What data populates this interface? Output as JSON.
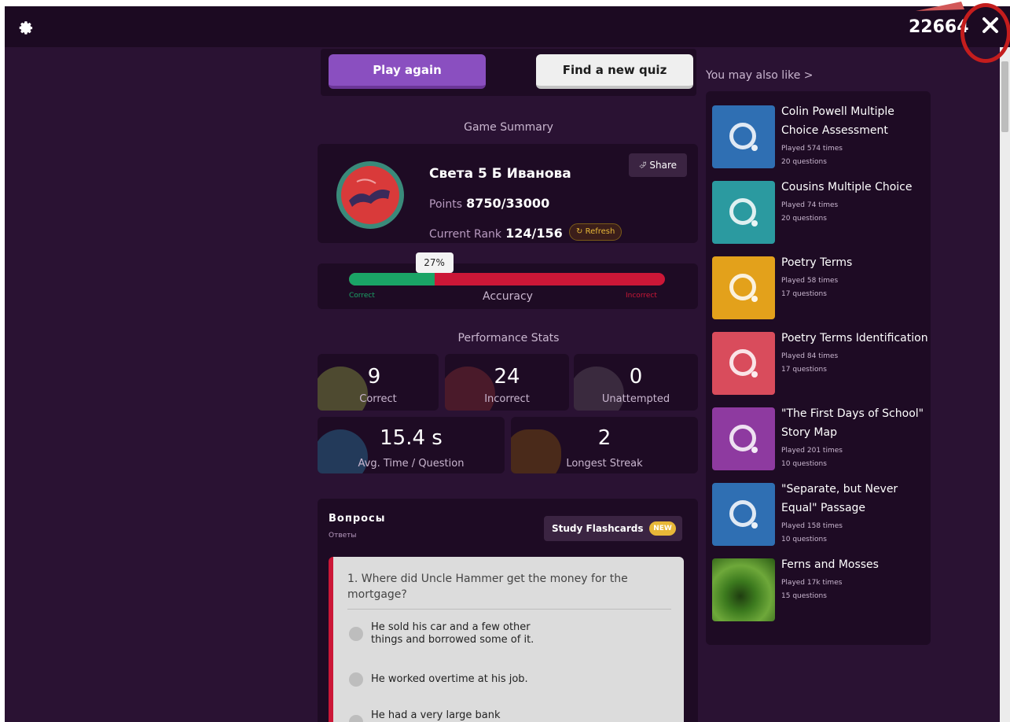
{
  "topbar": {
    "score": "22664",
    "gear_icon": "gear-icon",
    "close_icon": "close-icon"
  },
  "buttons": {
    "play_again": "Play again",
    "find_quiz": "Find a new quiz"
  },
  "summary": {
    "title": "Game Summary",
    "player_name": "Света 5 Б Иванова",
    "points_label": "Points",
    "points_value": "8750/33000",
    "rank_label": "Current Rank",
    "rank_value": "124/156",
    "refresh_label": "Refresh",
    "share_label": "Share"
  },
  "accuracy": {
    "label": "Accuracy",
    "value_text": "27%",
    "correct_label": "Correct",
    "incorrect_label": "Incorrect",
    "percent": 27
  },
  "performance": {
    "title": "Performance Stats",
    "correct_value": "9",
    "correct_label": "Correct",
    "incorrect_value": "24",
    "incorrect_label": "Incorrect",
    "unattempted_value": "0",
    "unattempted_label": "Unattempted",
    "avg_time_value": "15.4 s",
    "avg_time_label": "Avg. Time / Question",
    "streak_value": "2",
    "streak_label": "Longest Streak"
  },
  "review": {
    "title": "Вопросы",
    "subtitle": "Ответы",
    "flash_label": "Study Flashcards",
    "flash_badge": "NEW",
    "question": "1. Where did Uncle Hammer get the money for the mortgage?",
    "options": [
      "He sold his car and a few other things and borrowed some of it.",
      "He worked overtime at his job.",
      "He had a very large bank account."
    ]
  },
  "recommendations": {
    "header": "You may also like >",
    "items": [
      {
        "title": "Colin Powell Multiple Choice Assessment",
        "played": "Played 574 times",
        "questions": "20 questions",
        "color": "#2f6fb3"
      },
      {
        "title": "Cousins Multiple Choice",
        "played": "Played 74 times",
        "questions": "20 questions",
        "color": "#2b9aa0"
      },
      {
        "title": "Poetry Terms",
        "played": "Played 58 times",
        "questions": "17 questions",
        "color": "#e3a11b"
      },
      {
        "title": "Poetry Terms Identification",
        "played": "Played 84 times",
        "questions": "17 questions",
        "color": "#d94c5c"
      },
      {
        "title": "\"The First Days of School\" Story Map",
        "played": "Played 201 times",
        "questions": "10 questions",
        "color": "#8e3aa0"
      },
      {
        "title": "\"Separate, but Never Equal\" Passage",
        "played": "Played 158 times",
        "questions": "10 questions",
        "color": "#2f6fb3"
      },
      {
        "title": "Ferns and Mosses",
        "played": "Played 17k times",
        "questions": "15 questions",
        "color": "#3c7a1e"
      }
    ]
  }
}
